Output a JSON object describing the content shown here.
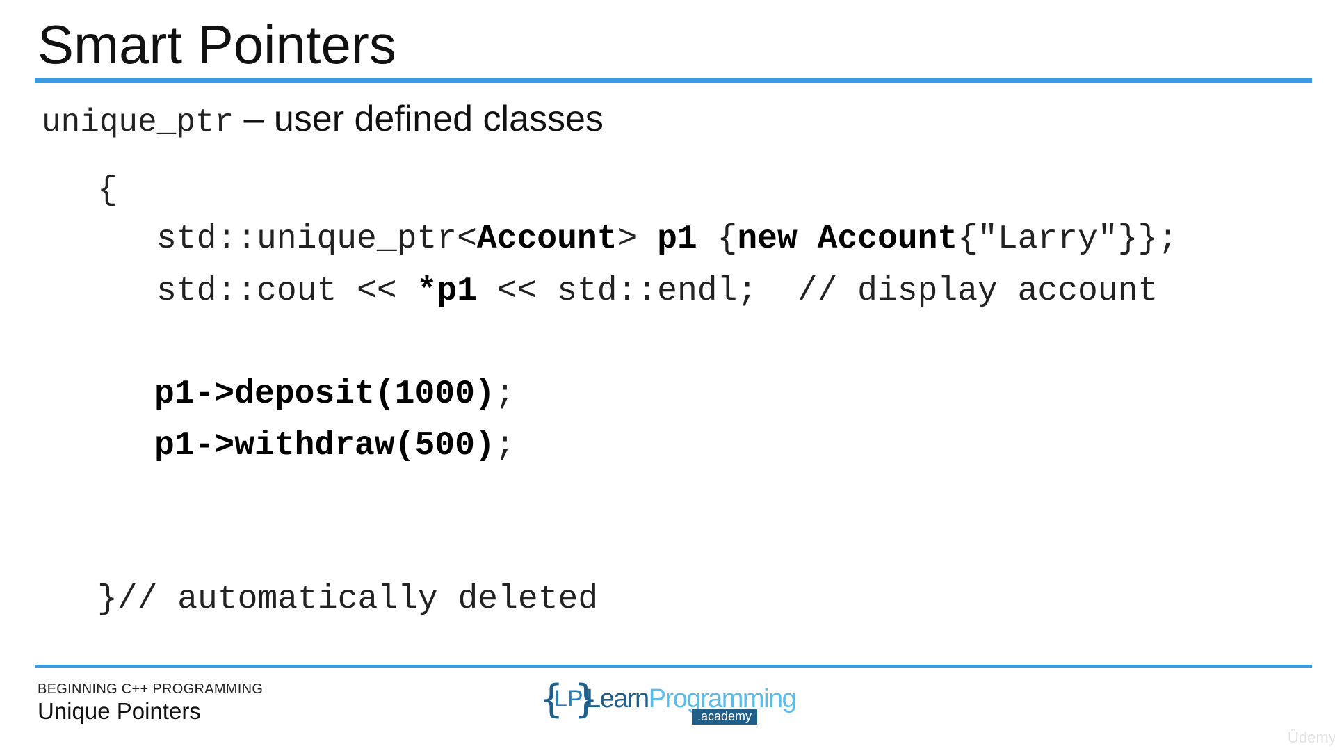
{
  "slide": {
    "title": "Smart Pointers",
    "subtitle_code": "unique_ptr",
    "subtitle_text": " – user defined classes"
  },
  "code": {
    "open_brace": "{",
    "line1": {
      "p1": "std::unique_ptr<",
      "p2": "Account",
      "p3": "> ",
      "p4": "p1",
      "p5": " {",
      "p6": "new Account",
      "p7": "{\"Larry\"}};"
    },
    "line2": {
      "p1": "std::cout << ",
      "p2": "*p1",
      "p3": " << std::endl;  // display account"
    },
    "line3": {
      "p1": "p1->deposit(1000)",
      "p2": ";"
    },
    "line4": {
      "p1": "p1->withdraw(500)",
      "p2": ";"
    },
    "close_line": "}// automatically deleted"
  },
  "footer": {
    "course": "BEGINNING C++ PROGRAMMING",
    "lecture": "Unique Pointers",
    "logo_brace_open": "{",
    "logo_lp": "LP",
    "logo_brace_close": "}",
    "logo_learn": "Learn",
    "logo_programming": "Programming",
    "logo_academy": ".academy",
    "watermark": "Ûdemy"
  },
  "colors": {
    "accent_rule": "#3b9ae0",
    "logo_dark": "#1f5f8a",
    "logo_light": "#5bbce8"
  }
}
